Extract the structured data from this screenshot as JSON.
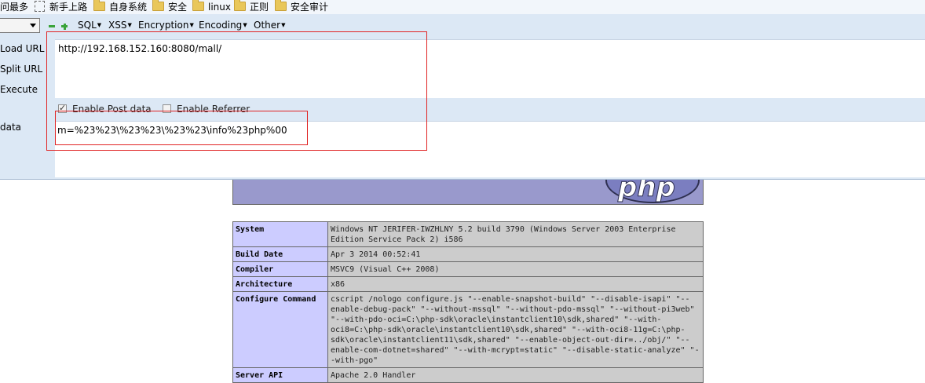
{
  "bookmarks": {
    "items": [
      {
        "label": "问最多",
        "icon": "none"
      },
      {
        "label": "新手上路",
        "icon": "dashed-box-icon"
      },
      {
        "label": "自身系统",
        "icon": "folder-icon"
      },
      {
        "label": "安全",
        "icon": "folder-icon"
      },
      {
        "label": "linux",
        "icon": "folder-icon"
      },
      {
        "label": "正则",
        "icon": "folder-icon"
      },
      {
        "label": "安全审计",
        "icon": "folder-icon"
      }
    ]
  },
  "hackbar": {
    "menu": {
      "sql": "SQL",
      "xss": "XSS",
      "encryption": "Encryption",
      "encoding": "Encoding",
      "other": "Other"
    },
    "side": {
      "load_url": "Load URL",
      "split_url": "Split URL",
      "execute": "Execute",
      "post_data": "data"
    },
    "url_value": "http://192.168.152.160:8080/mall/",
    "post_value": "m=%23%23\\%23%23\\%23%23\\info%23php%00",
    "enable_post": {
      "label": "Enable Post data",
      "checked": true
    },
    "enable_referrer": {
      "label": "Enable Referrer",
      "checked": false
    },
    "accent_colors": {
      "toolbar_bg": "#dce8f5",
      "highlight": "#e02424",
      "add_remove": "#3aa33a"
    }
  },
  "phpinfo": {
    "logo_text": "php",
    "colors": {
      "header": "#9999cc",
      "label_cell": "#ccccff",
      "value_cell": "#cccccc"
    },
    "rows": [
      {
        "label": "System",
        "value": "Windows NT JERIFER-IWZHLNY 5.2 build 3790 (Windows Server 2003 Enterprise Edition Service Pack 2) i586"
      },
      {
        "label": "Build Date",
        "value": "Apr 3 2014 00:52:41"
      },
      {
        "label": "Compiler",
        "value": "MSVC9 (Visual C++ 2008)"
      },
      {
        "label": "Architecture",
        "value": "x86"
      },
      {
        "label": "Configure Command",
        "value": "cscript /nologo configure.js \"--enable-snapshot-build\" \"--disable-isapi\" \"--enable-debug-pack\" \"--without-mssql\" \"--without-pdo-mssql\" \"--without-pi3web\" \"--with-pdo-oci=C:\\php-sdk\\oracle\\instantclient10\\sdk,shared\" \"--with-oci8=C:\\php-sdk\\oracle\\instantclient10\\sdk,shared\" \"--with-oci8-11g=C:\\php-sdk\\oracle\\instantclient11\\sdk,shared\" \"--enable-object-out-dir=../obj/\" \"--enable-com-dotnet=shared\" \"--with-mcrypt=static\" \"--disable-static-analyze\" \"--with-pgo\""
      },
      {
        "label": "Server API",
        "value": "Apache 2.0 Handler"
      }
    ]
  }
}
